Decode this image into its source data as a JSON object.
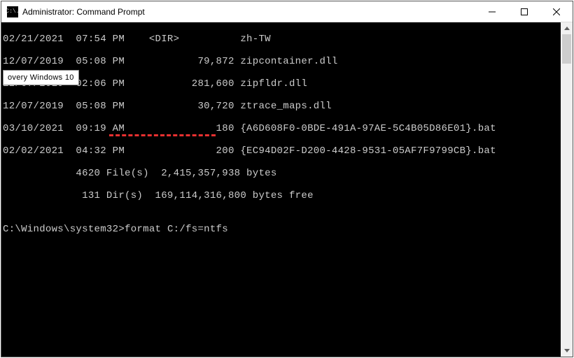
{
  "window": {
    "title": "Administrator: Command Prompt",
    "icon_label": "C:\\."
  },
  "tooltip": "overy Windows 10",
  "lines": {
    "l0": "02/21/2021  07:54 PM    <DIR>          zh-TW",
    "l1": "12/07/2019  05:08 PM            79,872 zipcontainer.dll",
    "l2": "12/07/2019  02:06 PM           281,600 zipfldr.dll",
    "l3": "12/07/2019  05:08 PM            30,720 ztrace_maps.dll",
    "l4": "03/10/2021  09:19 AM               180 {A6D608F0-0BDE-491A-97AE-5C4B05D86E01}.bat",
    "l5": "02/02/2021  04:32 PM               200 {EC94D02F-D200-4428-9531-05AF7F9799CB}.bat",
    "l6": "            4620 File(s)  2,415,357,938 bytes",
    "l7": "             131 Dir(s)  169,114,316,800 bytes free",
    "blank": "",
    "prompt": "C:\\Windows\\system32>",
    "command": "format C:/fs=ntfs"
  },
  "annotation": {
    "underline_target": "format C:/fs=ntfs"
  }
}
